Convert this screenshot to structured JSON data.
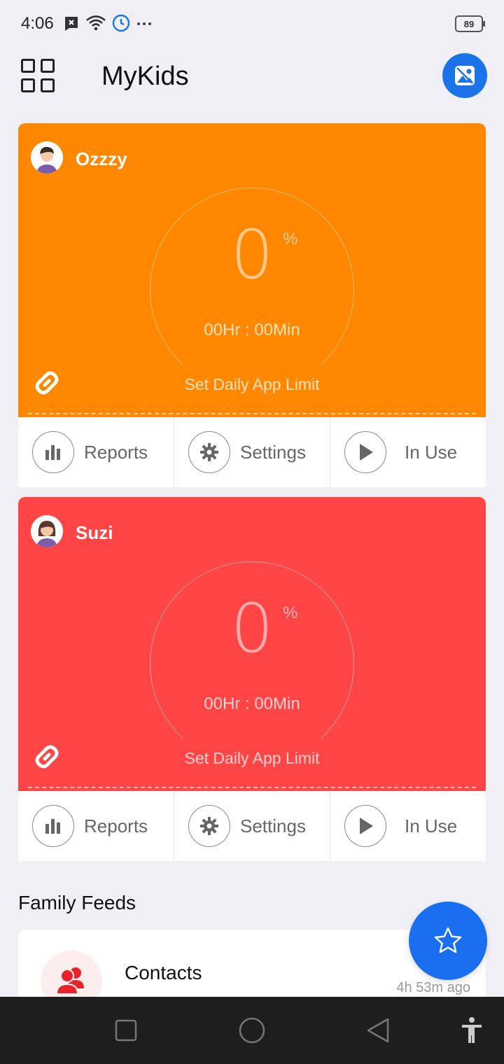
{
  "status_bar": {
    "time": "4:06",
    "battery": "89"
  },
  "header": {
    "title": "MyKids"
  },
  "kids": [
    {
      "name": "Ozzzy",
      "color": "#ff8800",
      "percent": "0",
      "percent_sign": "%",
      "time_used": "00Hr : 00Min",
      "limit_label": "Set Daily App Limit",
      "actions": {
        "reports": "Reports",
        "settings": "Settings",
        "in_use": "In Use"
      }
    },
    {
      "name": "Suzi",
      "color": "#ff4545",
      "percent": "0",
      "percent_sign": "%",
      "time_used": "00Hr : 00Min",
      "limit_label": "Set Daily App Limit",
      "actions": {
        "reports": "Reports",
        "settings": "Settings",
        "in_use": "In Use"
      }
    }
  ],
  "feeds": {
    "title": "Family Feeds",
    "items": [
      {
        "title": "Contacts",
        "time": "4h 53m ago"
      }
    ]
  },
  "colors": {
    "accent": "#1a73e8",
    "background": "#efeff5",
    "contacts_icon": "#e8242b"
  },
  "icons": {
    "menu": "grid-icon",
    "gallery": "image-icon",
    "link": "link-icon",
    "reports": "bar-chart-icon",
    "settings": "gear-icon",
    "in_use": "play-icon",
    "fab": "star-icon",
    "contacts": "people-icon"
  }
}
